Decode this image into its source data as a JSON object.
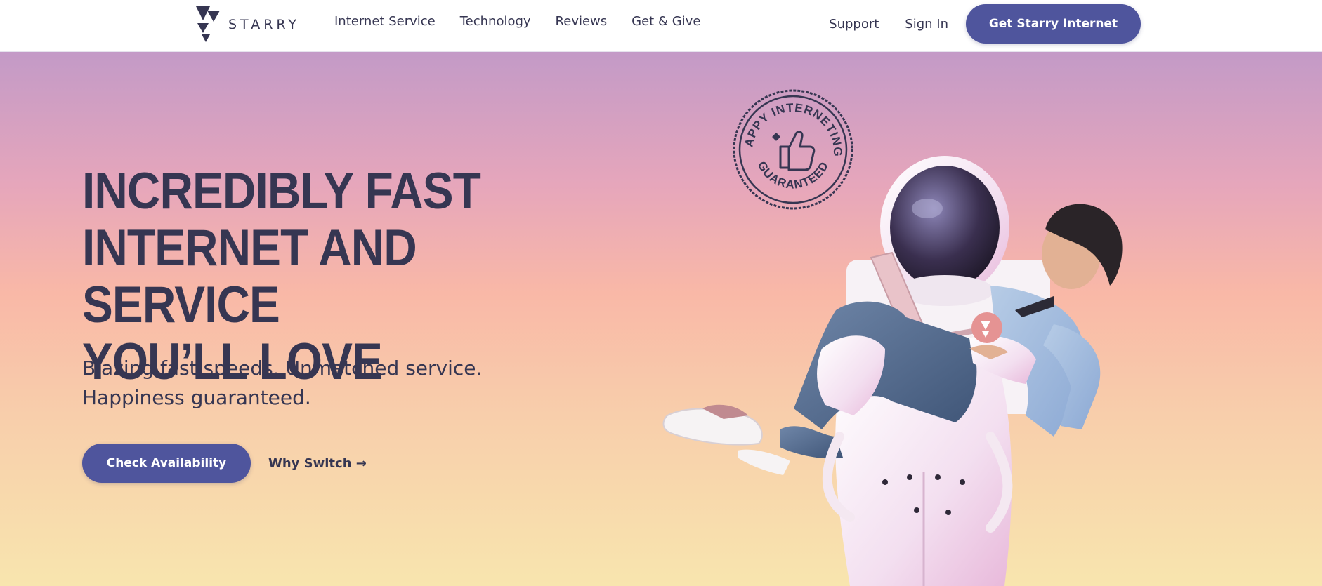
{
  "brand": {
    "name": "STARRY",
    "logo_icon": "starry-triangles-logo"
  },
  "nav": {
    "links": [
      "Internet Service",
      "Technology",
      "Reviews",
      "Get & Give"
    ],
    "support": "Support",
    "sign_in": "Sign In",
    "cta": "Get Starry Internet"
  },
  "hero": {
    "headline_lines": [
      "INCREDIBLY FAST",
      "INTERNET AND SERVICE",
      "YOU’LL LOVE"
    ],
    "subhead_lines": [
      "Blazing fast speeds. Unmatched service.",
      "Happiness guaranteed."
    ],
    "cta": "Check Availability",
    "secondary_link": "Why Switch →",
    "badge_text_top": "HAPPY INTERNETING",
    "badge_text_bottom": "GUARANTEED",
    "badge_icon": "thumbs-up-icon"
  },
  "colors": {
    "brand_primary": "#4f559d",
    "text_dark": "#363652",
    "gradient_top": "#c39ac7",
    "gradient_bottom": "#f8e5ae"
  }
}
